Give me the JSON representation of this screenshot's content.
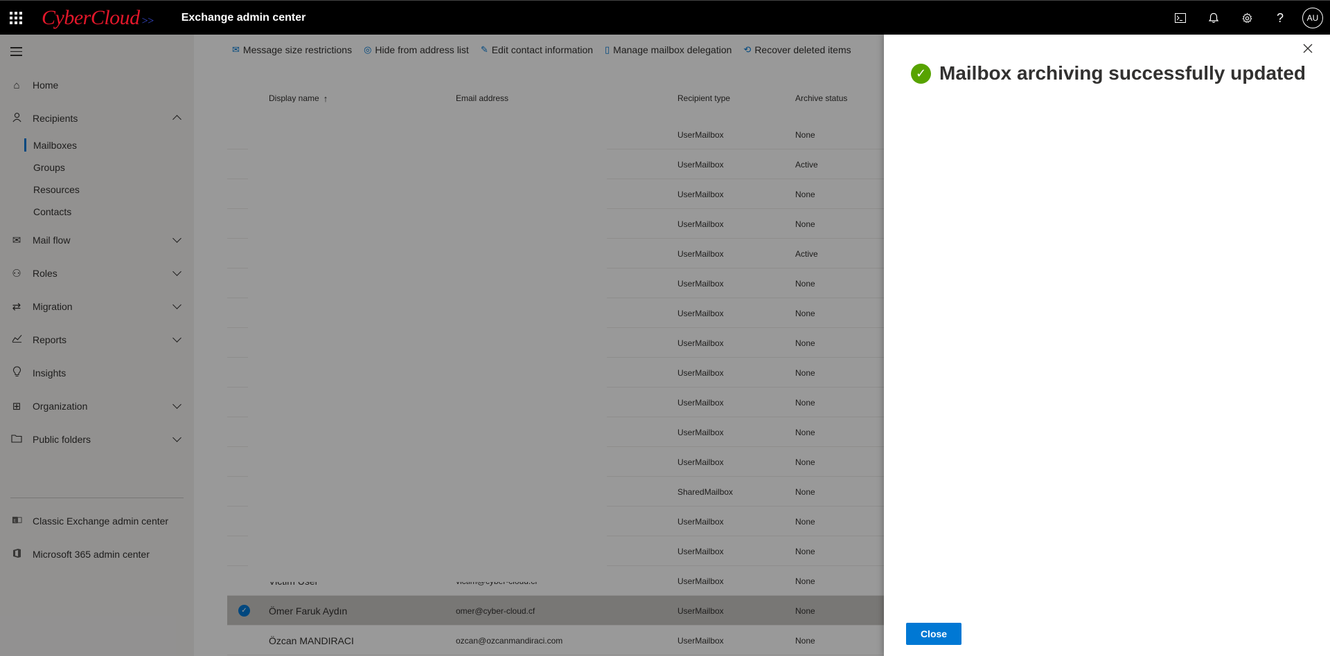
{
  "topbar": {
    "logo_text": "CyberCloud",
    "logo_arrows": ">>",
    "app_title": "Exchange admin center",
    "avatar_initials": "AU"
  },
  "nav": {
    "items": [
      {
        "label": "Home"
      },
      {
        "label": "Recipients"
      },
      {
        "label": "Mail flow"
      },
      {
        "label": "Roles"
      },
      {
        "label": "Migration"
      },
      {
        "label": "Reports"
      },
      {
        "label": "Insights"
      },
      {
        "label": "Organization"
      },
      {
        "label": "Public folders"
      }
    ],
    "recipients_sub": [
      {
        "label": "Mailboxes"
      },
      {
        "label": "Groups"
      },
      {
        "label": "Resources"
      },
      {
        "label": "Contacts"
      }
    ],
    "external": [
      {
        "label": "Classic Exchange admin center"
      },
      {
        "label": "Microsoft 365 admin center"
      }
    ]
  },
  "toolbar": {
    "message_size": "Message size restrictions",
    "hide_address": "Hide from address list",
    "edit_contact": "Edit contact information",
    "manage_delegation": "Manage mailbox delegation",
    "recover_deleted": "Recover deleted items"
  },
  "table": {
    "headers": {
      "display_name": "Display name",
      "sort_arrow": "↑",
      "email": "Email address",
      "recipient_type": "Recipient type",
      "archive_status": "Archive status"
    },
    "rows": [
      {
        "name": "",
        "email": "",
        "type": "UserMailbox",
        "archive": "None"
      },
      {
        "name": "",
        "email": "",
        "type": "UserMailbox",
        "archive": "Active"
      },
      {
        "name": "",
        "email": "",
        "type": "UserMailbox",
        "archive": "None"
      },
      {
        "name": "",
        "email": "",
        "type": "UserMailbox",
        "archive": "None"
      },
      {
        "name": "",
        "email": "",
        "type": "UserMailbox",
        "archive": "Active"
      },
      {
        "name": "",
        "email": "",
        "type": "UserMailbox",
        "archive": "None"
      },
      {
        "name": "",
        "email": "",
        "type": "UserMailbox",
        "archive": "None"
      },
      {
        "name": "",
        "email": "",
        "type": "UserMailbox",
        "archive": "None"
      },
      {
        "name": "",
        "email": "",
        "type": "UserMailbox",
        "archive": "None"
      },
      {
        "name": "",
        "email": "",
        "type": "UserMailbox",
        "archive": "None"
      },
      {
        "name": "",
        "email": "",
        "type": "UserMailbox",
        "archive": "None"
      },
      {
        "name": "",
        "email": "",
        "type": "UserMailbox",
        "archive": "None"
      },
      {
        "name": "",
        "email": "",
        "type": "SharedMailbox",
        "archive": "None"
      },
      {
        "name": "",
        "email": "",
        "type": "UserMailbox",
        "archive": "None"
      },
      {
        "name": "",
        "email": "",
        "type": "UserMailbox",
        "archive": "None"
      },
      {
        "name": "Victim User",
        "email": "victim@cyber-cloud.cf",
        "type": "UserMailbox",
        "archive": "None"
      },
      {
        "name": "Ömer Faruk Aydın",
        "email": "omer@cyber-cloud.cf",
        "type": "UserMailbox",
        "archive": "None",
        "selected": true
      },
      {
        "name": "Özcan MANDIRACI",
        "email": "ozcan@ozcanmandiraci.com",
        "type": "UserMailbox",
        "archive": "None"
      }
    ]
  },
  "flyout": {
    "title": "Mailbox archiving successfully updated",
    "close_button": "Close"
  },
  "colors": {
    "accent": "#0078d4",
    "success": "#57a300",
    "topbar": "#000000",
    "nav_bg": "#f3f2f1"
  }
}
